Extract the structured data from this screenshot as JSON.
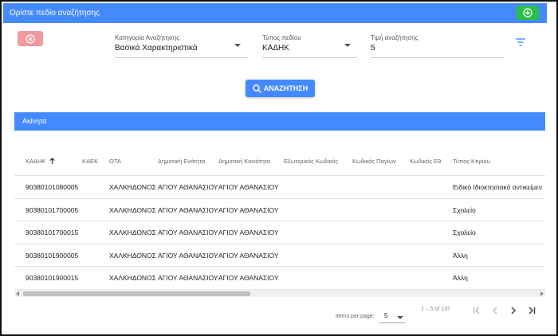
{
  "topbar": {
    "title": "Ορίστε πεδίο αναζήτησης"
  },
  "filters": {
    "category": {
      "label": "Κατηγορία Αναζήτησης",
      "value": "Βασικά Χαρακτηριστικά"
    },
    "field_type": {
      "label": "Τύπος πεδίου",
      "value": "ΚΑΔΗΚ"
    },
    "search_value": {
      "label": "Τιμή αναζήτησης",
      "value": "5"
    }
  },
  "search_button": {
    "label": "ΑΝΑΖΗΤΗΣΗ"
  },
  "section": {
    "title": "Ακίνητα"
  },
  "table": {
    "columns": [
      "ΚΑΔΗΚ",
      "ΚΑΕΚ",
      "ΟΤΑ",
      "Δημοτική Ενότητα",
      "Δημοτική Κοινότητα",
      "Εξωτερικός Κωδικός",
      "Κωδικός Παγίων",
      "Κωδικός Ε9",
      "Τύπος Κτιρίου"
    ],
    "rows": [
      [
        "90380101080005",
        "",
        "ΧΑΛΚΗΔΟΝΟΣ",
        "ΑΓΙΟΥ ΑΘΑΝΑΣΙΟΥ",
        "ΑΓΙΟΥ ΑΘΑΝΑΣΙΟΥ",
        "",
        "",
        "",
        "Ειδικό Ιδιοκτησιακό αντικείμεν"
      ],
      [
        "90380101700005",
        "",
        "ΧΑΛΚΗΔΟΝΟΣ",
        "ΑΓΙΟΥ ΑΘΑΝΑΣΙΟΥ",
        "ΑΓΙΟΥ ΑΘΑΝΑΣΙΟΥ",
        "",
        "",
        "",
        "Σχολείο"
      ],
      [
        "90380101700015",
        "",
        "ΧΑΛΚΗΔΟΝΟΣ",
        "ΑΓΙΟΥ ΑΘΑΝΑΣΙΟΥ",
        "ΑΓΙΟΥ ΑΘΑΝΑΣΙΟΥ",
        "",
        "",
        "",
        "Σχολείο"
      ],
      [
        "90380101900005",
        "",
        "ΧΑΛΚΗΔΟΝΟΣ",
        "ΑΓΙΟΥ ΑΘΑΝΑΣΙΟΥ",
        "ΑΓΙΟΥ ΑΘΑΝΑΣΙΟΥ",
        "",
        "",
        "",
        "Άλλη"
      ],
      [
        "90380101900015",
        "",
        "ΧΑΛΚΗΔΟΝΟΣ",
        "ΑΓΙΟΥ ΑΘΑΝΑΣΙΟΥ",
        "ΑΓΙΟΥ ΑΘΑΝΑΣΙΟΥ",
        "",
        "",
        "",
        "Άλλη"
      ]
    ]
  },
  "paginator": {
    "items_per_page_label": "Items per page:",
    "page_size": "5",
    "range": "1 – 5 of 137"
  },
  "colors": {
    "primary": "#448aff",
    "add": "#2bbf4a",
    "clear": "#ee9a9f"
  },
  "icons": [
    "plus-circle-icon",
    "close-circle-icon",
    "caret-down-icon",
    "filter-icon",
    "search-icon",
    "sort-arrow-up-icon",
    "first-page-icon",
    "prev-page-icon",
    "next-page-icon",
    "last-page-icon"
  ]
}
